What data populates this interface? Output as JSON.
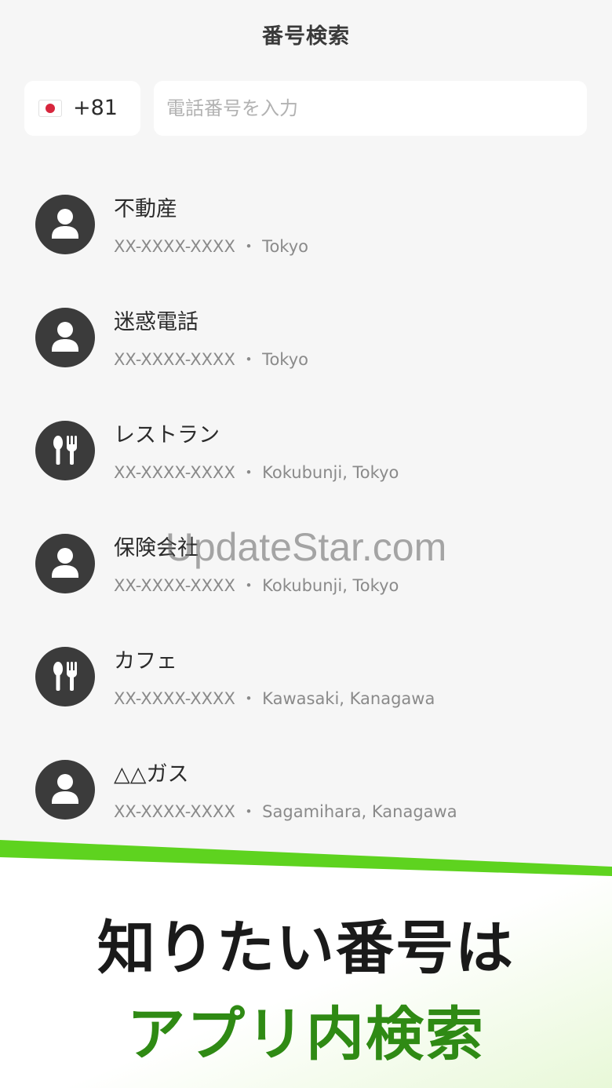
{
  "header": {
    "title": "番号検索"
  },
  "search": {
    "flag_icon": "japan-flag-icon",
    "country_code": "+81",
    "placeholder": "電話番号を入力",
    "value": ""
  },
  "results": [
    {
      "icon": "person-icon",
      "name": "不動産",
      "detail": "XX-XXXX-XXXX ・ Tokyo"
    },
    {
      "icon": "person-icon",
      "name": "迷惑電話",
      "detail": "XX-XXXX-XXXX  ・ Tokyo"
    },
    {
      "icon": "restaurant-icon",
      "name": "レストラン",
      "detail": "XX-XXXX-XXXX ・ Kokubunji, Tokyo"
    },
    {
      "icon": "person-icon",
      "name": "保険会社",
      "detail": "XX-XXXX-XXXX ・ Kokubunji, Tokyo"
    },
    {
      "icon": "restaurant-icon",
      "name": "カフェ",
      "detail": "XX-XXXX-XXXX ・ Kawasaki, Kanagawa"
    },
    {
      "icon": "person-icon",
      "name": "△△ガス",
      "detail": "XX-XXXX-XXXX ・ Sagamihara, Kanagawa"
    }
  ],
  "watermark": "UpdateStar.com",
  "promo": {
    "line1": "知りたい番号は",
    "line2": "アプリ内検索",
    "accent_color": "#5ed31f",
    "highlight_color": "#2f8a14"
  },
  "colors": {
    "background": "#f6f6f6",
    "avatar": "#3b3b3b",
    "secondary_text": "#8a8a8a"
  }
}
